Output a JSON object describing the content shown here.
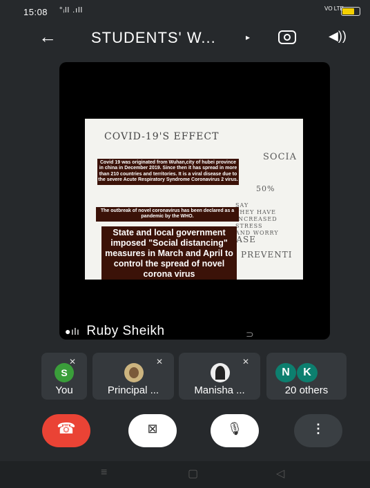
{
  "status": {
    "time": "15:08",
    "signal": "°ᵢll .ıll",
    "volte": "VO LTE",
    "battery_level": 0.7,
    "battery_color": "#f5d000"
  },
  "header": {
    "title": "STUDENTS' W...",
    "back_icon": "←",
    "caret": "▸",
    "speaker_icon": "◀))"
  },
  "video": {
    "speaker_name": "Ruby Sheikh",
    "whiteboard": {
      "heading": "COVID-19'S EFFECT",
      "side_heading": "SOCIA",
      "stat": "50%",
      "stat_note": "SAY\nTHEY HAVE\nINCREASED\nSTRESS\nAND WORRY",
      "disease": "DISEASE",
      "prevent": "PREVENTI"
    },
    "paragraph1": "Covid 19 was originated from Wuhan,city of hubei province in china in December 2019. Since then it has spread in more than 210 countries and territories. It is a viral disease due to the severe Acute Respiratory Syndrome Coronavirus 2 virus.",
    "paragraph2": "The outbreak of novel coronavirus has been declared as a pandemic by the WHO.",
    "paragraph3": "State and local government imposed \"Social distancing\" measures in March and April to control the spread of novel corona virus"
  },
  "participants": [
    {
      "label": "You",
      "initial": "S",
      "color": "#3a9e3a"
    },
    {
      "label": "Principal ..."
    },
    {
      "label": "Manisha ..."
    },
    {
      "label": "20 others",
      "initials": [
        "N",
        "K"
      ],
      "color": "#0d7f6f"
    }
  ],
  "controls": {
    "end_icon": "☎",
    "camera_icon": "⊠",
    "mic_icon": "🎙",
    "more_icon": "⋮"
  },
  "navbar": {
    "menu": "≡",
    "home": "▢",
    "back": "◁"
  }
}
